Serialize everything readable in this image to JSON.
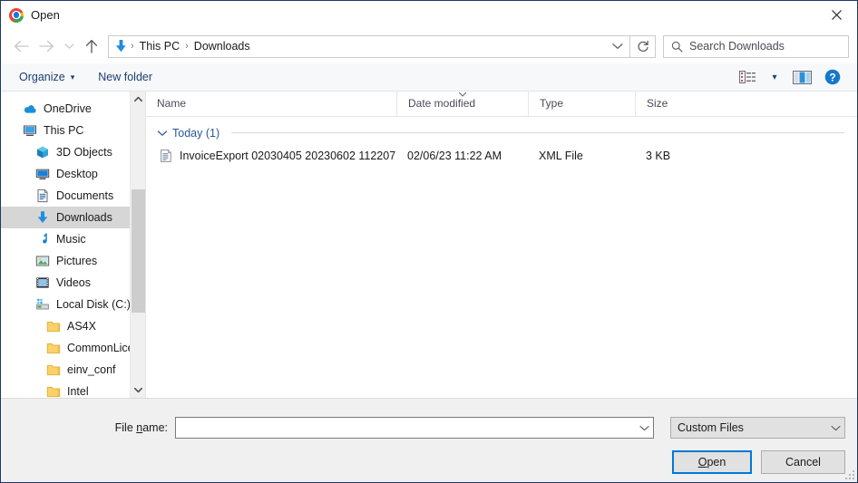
{
  "window": {
    "title": "Open",
    "app_icon": "chrome-icon",
    "close_label": "✕",
    "border_color": "#1f3864"
  },
  "nav": {
    "back_icon": "back-arrow-icon",
    "forward_icon": "forward-arrow-icon",
    "recent_icon": "recent-locations-chevron-icon",
    "up_icon": "up-arrow-icon",
    "breadcrumb": {
      "location_icon": "downloads-arrow-icon",
      "items": [
        "This PC",
        "Downloads"
      ],
      "separator": "›",
      "dropdown_icon": "chevron-down-icon"
    },
    "refresh_icon": "refresh-icon"
  },
  "search": {
    "icon": "search-icon",
    "placeholder": "Search Downloads",
    "value": ""
  },
  "toolbar": {
    "organize_label": "Organize",
    "organize_caret": "▾",
    "new_folder_label": "New folder",
    "view_icon": "view-options-icon",
    "view_caret": "▾",
    "preview_pane_icon": "preview-pane-icon",
    "help_icon": "help-icon",
    "help_glyph": "?"
  },
  "sidebar": {
    "items": [
      {
        "label": "OneDrive",
        "icon": "onedrive-cloud-icon",
        "level": 0,
        "selected": false
      },
      {
        "label": "This PC",
        "icon": "this-pc-monitor-icon",
        "level": 0,
        "selected": false
      },
      {
        "label": "3D Objects",
        "icon": "3d-objects-icon",
        "level": 1,
        "selected": false
      },
      {
        "label": "Desktop",
        "icon": "desktop-icon",
        "level": 1,
        "selected": false
      },
      {
        "label": "Documents",
        "icon": "documents-icon",
        "level": 1,
        "selected": false
      },
      {
        "label": "Downloads",
        "icon": "downloads-arrow-icon",
        "level": 1,
        "selected": true
      },
      {
        "label": "Music",
        "icon": "music-note-icon",
        "level": 1,
        "selected": false
      },
      {
        "label": "Pictures",
        "icon": "pictures-icon",
        "level": 1,
        "selected": false
      },
      {
        "label": "Videos",
        "icon": "videos-film-icon",
        "level": 1,
        "selected": false
      },
      {
        "label": "Local Disk (C:)",
        "icon": "local-disk-icon",
        "level": 1,
        "selected": false
      },
      {
        "label": "AS4X",
        "icon": "folder-icon",
        "level": 2,
        "selected": false
      },
      {
        "label": "CommonLicen",
        "icon": "folder-icon",
        "level": 2,
        "selected": false
      },
      {
        "label": "einv_conf",
        "icon": "folder-icon",
        "level": 2,
        "selected": false
      },
      {
        "label": "Intel",
        "icon": "folder-icon",
        "level": 2,
        "selected": false
      }
    ],
    "scrollbar": {
      "up_icon": "scroll-up-arrow-icon",
      "down_icon": "scroll-down-arrow-icon"
    }
  },
  "filelist": {
    "columns": [
      {
        "label": "Name",
        "sorted": false
      },
      {
        "label": "Date modified",
        "sorted": true
      },
      {
        "label": "Type",
        "sorted": false
      },
      {
        "label": "Size",
        "sorted": false
      }
    ],
    "group": {
      "collapse_icon": "chevron-down-icon",
      "label": "Today (1)"
    },
    "rows": [
      {
        "icon": "xml-file-icon",
        "name": "InvoiceExport 02030405 20230602 112207",
        "date_modified": "02/06/23 11:22 AM",
        "type": "XML File",
        "size": "3 KB"
      }
    ]
  },
  "footer": {
    "file_name_label_a": "File ",
    "file_name_label_u": "n",
    "file_name_label_b": "ame:",
    "file_name_value": "",
    "file_name_placeholder": "",
    "file_name_chevron_icon": "chevron-down-icon",
    "filter_value": "Custom Files",
    "filter_chevron_icon": "chevron-down-icon",
    "open_label_a": "",
    "open_label_u": "O",
    "open_label_b": "pen",
    "cancel_label": "Cancel",
    "resize_grip_icon": "resize-grip-icon"
  },
  "colors": {
    "accent": "#0078d7",
    "group_header": "#2b579a",
    "toolbar_text": "#1c3f70",
    "selection": "#d6d6d6",
    "window_border": "#1f3864"
  }
}
